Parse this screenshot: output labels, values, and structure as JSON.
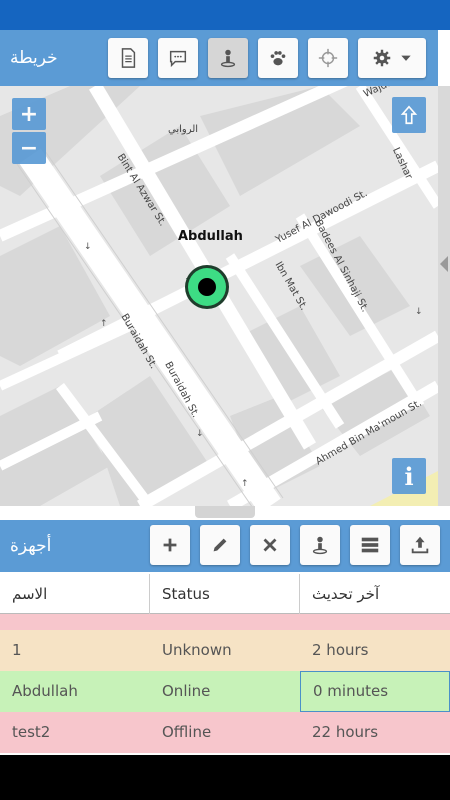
{
  "map_toolbar": {
    "title": "خريطة",
    "buttons": [
      "document-icon",
      "chat-icon",
      "person-pin-icon",
      "paw-icon",
      "crosshair-icon",
      "gear-dropdown-icon"
    ]
  },
  "map": {
    "zoom_in": "+",
    "zoom_out": "−",
    "info": "i",
    "device_label": "Abdullah",
    "streets": {
      "wajdan": "Wajdan",
      "lashar": "Lashar",
      "alrawabi": "الروابي",
      "bint_al_azwar": "Bint Al Azwar St.",
      "yusef": "Yusef Al Dawoodi St.",
      "badees": "Badees Al Sinhaji St.",
      "ibn_mat": "Ibn Mat St.",
      "buraidah1": "Buraidah St.",
      "buraidah2": "Buraidah St.",
      "ahmed": "Ahmed Bin Ma'moun St."
    },
    "colors": {
      "marker_fill": "#3ddc84",
      "marker_center": "#000000"
    }
  },
  "devices_toolbar": {
    "title": "أجهزة",
    "buttons": [
      "add-icon",
      "edit-icon",
      "delete-icon",
      "person-pin-icon",
      "list-icon",
      "upload-icon"
    ]
  },
  "table": {
    "headers": [
      "الاسم",
      "Status",
      "آخر تحديث"
    ],
    "rows": [
      {
        "name": "1",
        "status": "Unknown",
        "updated": "2 hours"
      },
      {
        "name": "Abdullah",
        "status": "Online",
        "updated": "0 minutes"
      },
      {
        "name": "test2",
        "status": "Offline",
        "updated": "22 hours"
      }
    ]
  },
  "colors": {
    "toolbar": "#5b9bd5",
    "statusbar": "#1565c0",
    "row_unknown": "#f6e3c5",
    "row_online": "#c7f2b8",
    "row_offline": "#f7c6cc"
  }
}
